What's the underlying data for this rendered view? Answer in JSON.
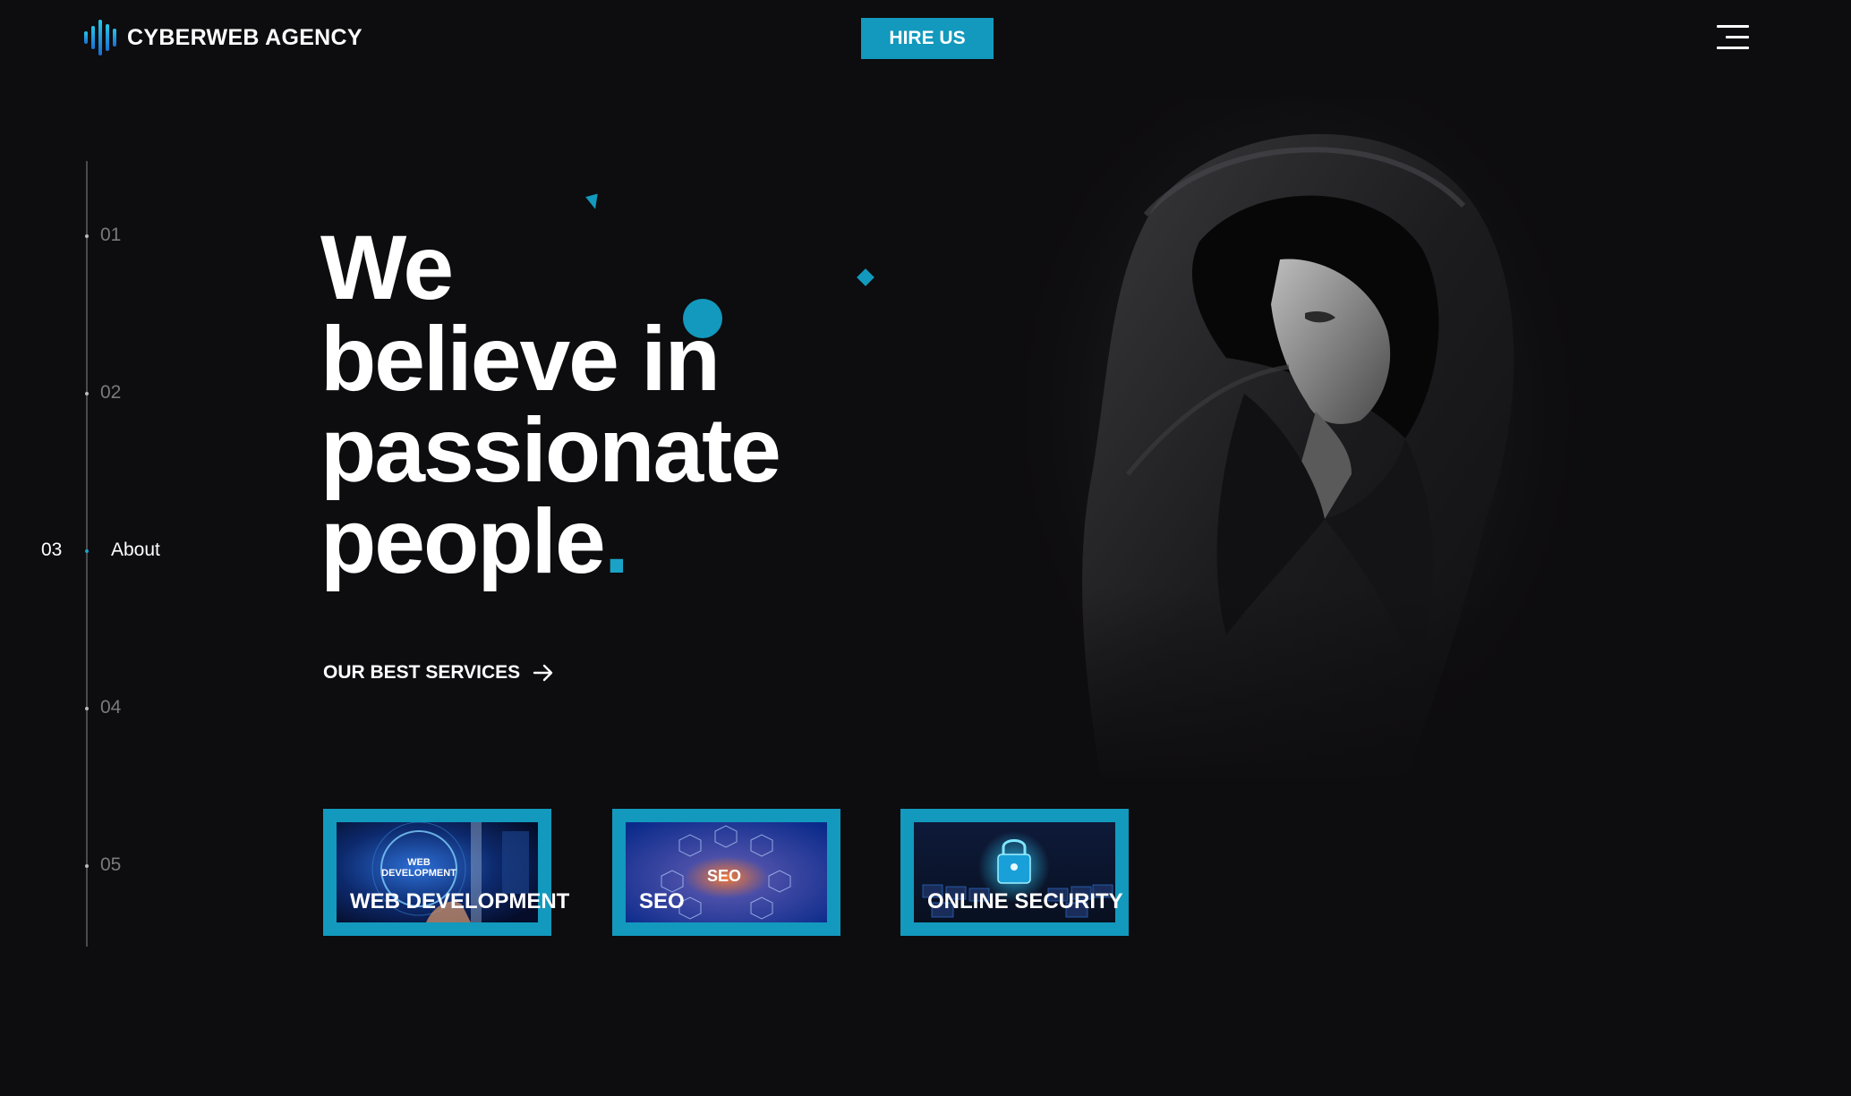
{
  "header": {
    "brand": "CYBERWEB AGENCY",
    "hire_label": "HIRE US"
  },
  "rail": {
    "items": [
      {
        "num": "01"
      },
      {
        "num": "02"
      },
      {
        "num": "03",
        "label": "About",
        "active": true
      },
      {
        "num": "04"
      },
      {
        "num": "05"
      }
    ]
  },
  "hero": {
    "line1": "We",
    "line2": "believe in",
    "line3": "passionate",
    "line4": "people",
    "period": "."
  },
  "services_link": "OUR BEST SERVICES",
  "cards": [
    {
      "title": "WEB DEVELOPMENT",
      "thumb_text": "WEB DEVELOPMENT"
    },
    {
      "title": "SEO",
      "thumb_text": "SEO"
    },
    {
      "title": "ONLINE SECURITY"
    }
  ],
  "colors": {
    "background": "#0d0c0e",
    "accent": "#1299bd",
    "text": "#ffffff",
    "muted": "#7a7a7e"
  },
  "icons": {
    "logo": "sound-wave-icon",
    "menu": "hamburger-menu-icon",
    "services_link": "arrow-right-icon"
  }
}
